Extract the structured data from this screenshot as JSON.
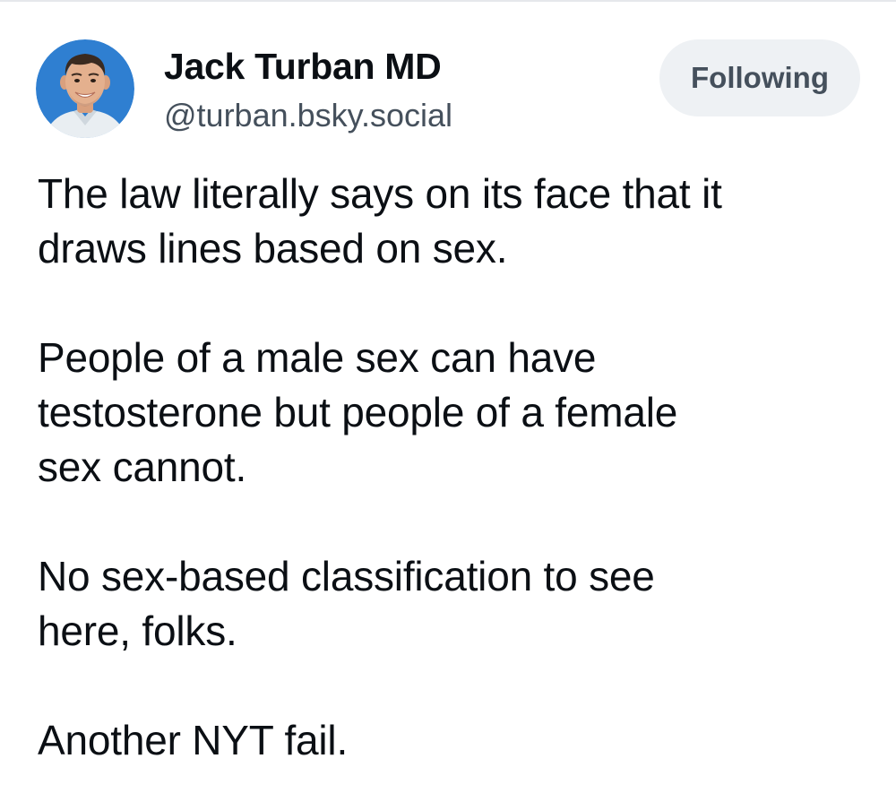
{
  "post": {
    "author": {
      "display_name": "Jack Turban MD",
      "handle": "@turban.bsky.social",
      "avatar_icon": "profile-photo"
    },
    "follow_button_label": "Following",
    "paragraphs": [
      "The law literally says on its face that it\ndraws lines based on sex.",
      "People of a male sex can have\ntestosterone but people of a female\nsex cannot.",
      "No sex-based classification to see\nhere, folks.",
      "Another NYT fail."
    ]
  },
  "colors": {
    "text": "#0b0f14",
    "secondary_text": "#45505c",
    "button_bg": "#eef1f4",
    "avatar_bg": "#2f7fd1"
  }
}
